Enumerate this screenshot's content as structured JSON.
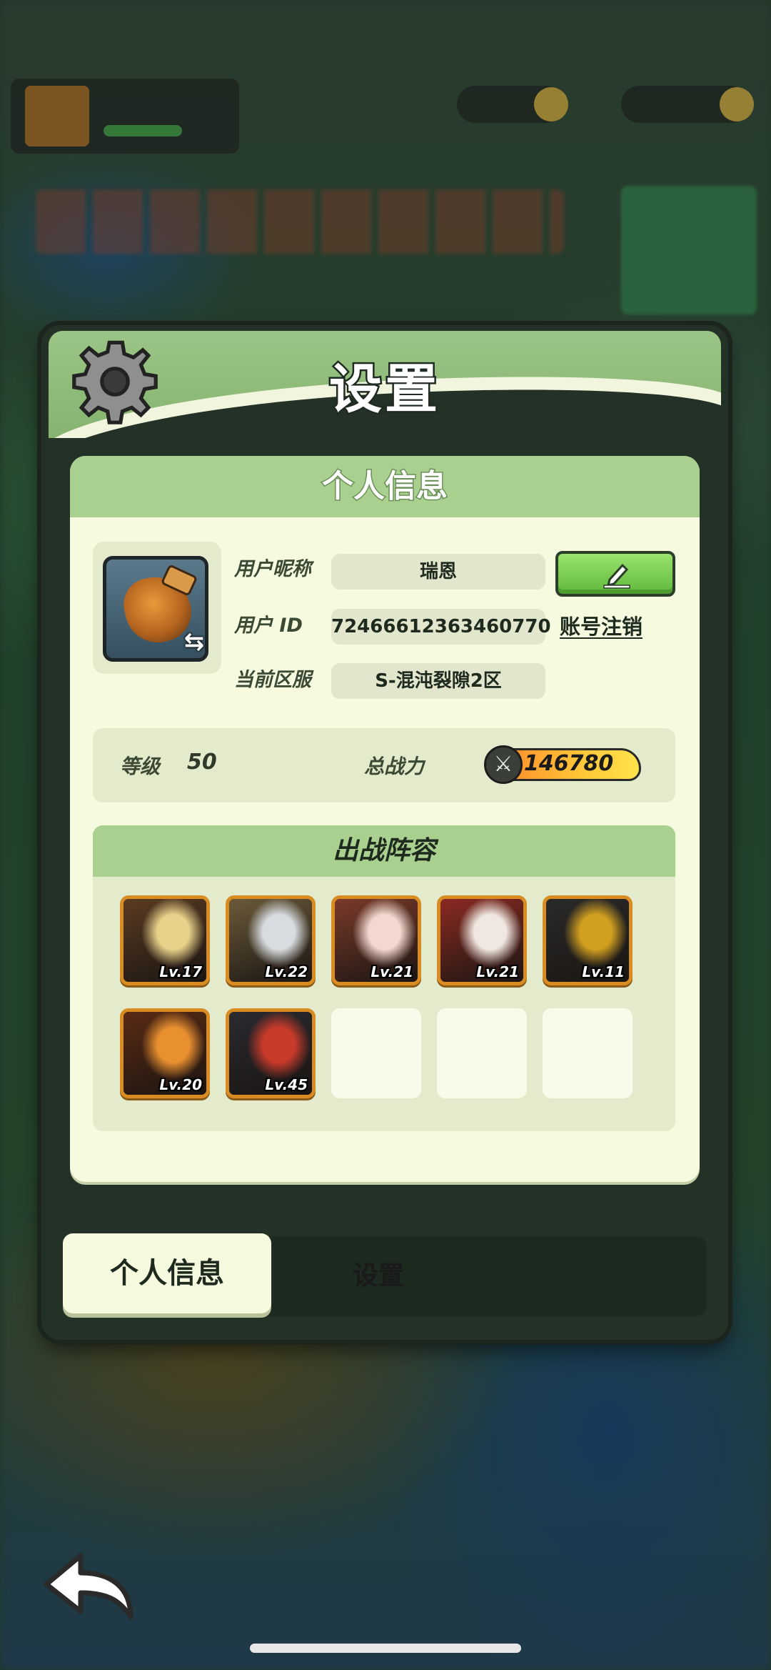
{
  "panel": {
    "title": "设置"
  },
  "personal": {
    "section_title": "个人信息",
    "nickname_label": "用户昵称",
    "nickname_value": "瑞恩",
    "id_label": "用户  ID",
    "id_value": "72466612363460770",
    "server_label": "当前区服",
    "server_value": "S-混沌裂隙2区",
    "logout_label": "账号注销"
  },
  "stats": {
    "level_label": "等级",
    "level_value": "50",
    "power_label": "总战力",
    "power_value": "146780"
  },
  "team": {
    "title": "出战阵容",
    "heroes": [
      {
        "level": "Lv.17",
        "colors": [
          "#5a3b22",
          "#e8d28a"
        ]
      },
      {
        "level": "Lv.22",
        "colors": [
          "#6b5a3a",
          "#d8dce0"
        ]
      },
      {
        "level": "Lv.21",
        "colors": [
          "#7a3a2a",
          "#f2d8d0"
        ]
      },
      {
        "level": "Lv.21",
        "colors": [
          "#8a2a22",
          "#f0e8e0"
        ]
      },
      {
        "level": "Lv.11",
        "colors": [
          "#2a2a2a",
          "#d2a020"
        ]
      },
      {
        "level": "Lv.20",
        "colors": [
          "#5a2a14",
          "#e89030"
        ]
      },
      {
        "level": "Lv.45",
        "colors": [
          "#2a2a30",
          "#c83a2a"
        ]
      }
    ],
    "empty_slots": 3
  },
  "tabs": {
    "active": "个人信息",
    "inactive": "设置"
  }
}
